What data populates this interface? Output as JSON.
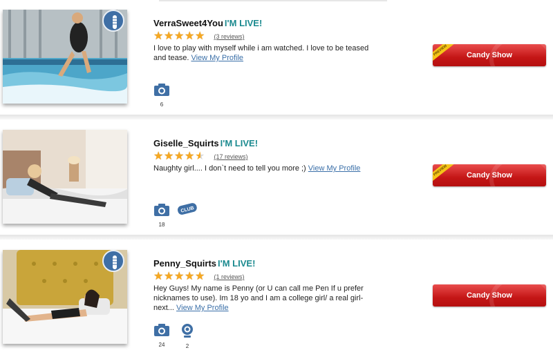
{
  "live_label": "I'M LIVE!",
  "colors": {
    "live": "#1b8a8f",
    "button": "#c41616",
    "link": "#3a6fa8",
    "star": "#f6a821",
    "badge": "#3f6fa5"
  },
  "models": [
    {
      "name": "VerraSweet4You",
      "rating": 5,
      "reviews": "(3 reviews)",
      "description": "I love to play with myself while i am watched. I love to be teased and tease.",
      "profile_link": "View My Profile",
      "toy_badge": true,
      "media": [
        {
          "icon": "camera-icon",
          "count": "6"
        }
      ],
      "club": false,
      "button": {
        "label": "Candy Show",
        "ribbon": "PREVIEW"
      }
    },
    {
      "name": "Giselle_Squirts",
      "rating": 4.5,
      "reviews": "(17 reviews)",
      "description": "Naughty girl.... I don`t need to tell you more ;)",
      "profile_link": "View My Profile",
      "toy_badge": false,
      "media": [
        {
          "icon": "camera-icon",
          "count": "18"
        }
      ],
      "club": true,
      "club_label": "CLUB",
      "button": {
        "label": "Candy Show",
        "ribbon": "PREVIEW"
      }
    },
    {
      "name": "Penny_Squirts",
      "rating": 5,
      "reviews": "(1 reviews)",
      "description": "Hey Guys! My name is Penny (or U can call me Pen If u prefer nicknames to use). Im 18 yo and I am a college girl/ a real girl-next...",
      "profile_link": "View My Profile",
      "toy_badge": true,
      "media": [
        {
          "icon": "camera-icon",
          "count": "24"
        },
        {
          "icon": "webcam-icon",
          "count": "2"
        }
      ],
      "club": false,
      "button": {
        "label": "Candy Show",
        "ribbon": ""
      }
    }
  ]
}
